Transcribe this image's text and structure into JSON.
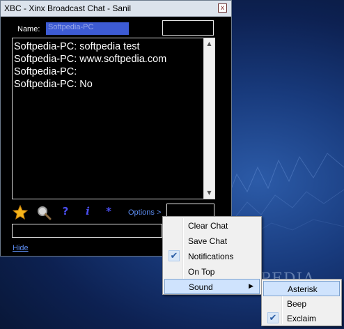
{
  "window": {
    "title": "XBC - Xinx Broadcast Chat - Sanil",
    "close_glyph": "x"
  },
  "name_field": {
    "label": "Name:",
    "value": "Softpedia-PC"
  },
  "chat": {
    "lines": [
      "Softpedia-PC: softpedia test",
      "Softpedia-PC: www.softpedia.com",
      "Softpedia-PC:",
      "Softpedia-PC: No"
    ],
    "scroll_up": "▲",
    "scroll_down": "▼"
  },
  "toolbar": {
    "help_glyph": "?",
    "info_glyph": "i",
    "asterisk_glyph": "*",
    "options_label": "Options >"
  },
  "hide_label": "Hide",
  "context_menu": {
    "items": [
      {
        "label": "Clear Chat",
        "checked": false
      },
      {
        "label": "Save Chat",
        "checked": false
      },
      {
        "label": "Notifications",
        "checked": true
      },
      {
        "label": "On Top",
        "checked": false
      },
      {
        "label": "Sound",
        "checked": false,
        "has_submenu": true,
        "highlighted": true
      }
    ],
    "check_glyph": "✔",
    "submenu_arrow": "▶"
  },
  "sound_submenu": {
    "items": [
      {
        "label": "Asterisk",
        "checked": false,
        "highlighted": true
      },
      {
        "label": "Beep",
        "checked": false
      },
      {
        "label": "Exclaim",
        "checked": true
      }
    ]
  },
  "desktop": {
    "watermark": "SOFTPEDIA",
    "watermark_sub": "www.softpedia.com"
  },
  "colors": {
    "window_bg": "#000000",
    "name_input_bg": "#3d5bd4",
    "link": "#5c8cf0",
    "menu_highlight": "#cfe3fd"
  }
}
